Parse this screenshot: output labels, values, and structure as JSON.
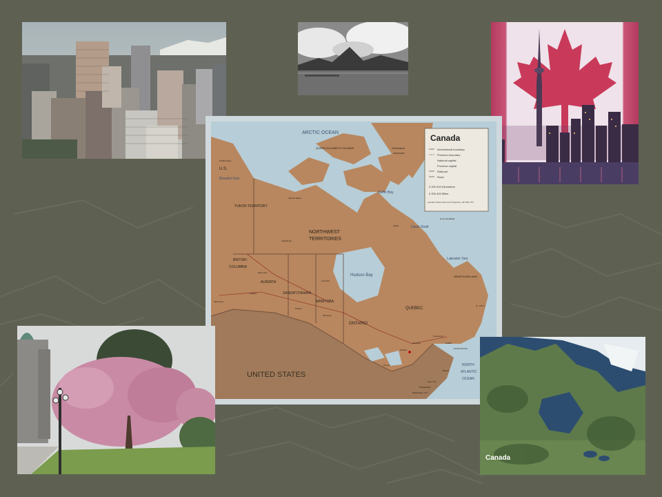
{
  "slide": {
    "background": "#5e6152",
    "map": {
      "legend": {
        "title": "Canada",
        "items": [
          "International boundary",
          "Province boundary",
          "National capital",
          "Province capital",
          "Railroad",
          "Road"
        ],
        "scale_km": "0    200    400 Kilometers",
        "scale_mi": "0    200    400 Miles",
        "projection": "Lambert Conformal Conic Projection, SP 49N 77N"
      },
      "labels": {
        "arctic_ocean": "ARCTIC OCEAN",
        "greenland": "Greenland",
        "greenland_denmark": "(DENMARK)",
        "beaufort_sea": "Beaufort Sea",
        "us": "U.S.",
        "prudhoe_bay": "Prudhoe Bay",
        "queen_elizabeth_islands": "QUEEN ELIZABETH ISLANDS",
        "baffin_bay": "Baffin Bay",
        "davis_strait": "Davis Strait",
        "nuuk": "Nuuk (Godthab)",
        "yukon": "YUKON TERRITORY",
        "nwt_1": "NORTHWEST",
        "nwt_2": "TERRITORIES",
        "bc_1": "BRITISH",
        "bc_2": "COLUMBIA",
        "alberta": "ALBERTA",
        "saskatchewan": "SASKATCHEWAN",
        "manitoba": "MANITOBA",
        "ontario": "ONTARIO",
        "quebec": "QUEBEC",
        "hudson_bay": "Hudson Bay",
        "labrador_sea": "Labrador Sea",
        "newfoundland": "NEWFOUNDLAND",
        "nova_scotia": "NOVA SCOTIA",
        "united_states": "UNITED STATES",
        "north_atlantic_1": "NORTH",
        "north_atlantic_2": "ATLANTIC",
        "north_atlantic_3": "OCEAN",
        "victoria_island": "Victoria Island",
        "yellowknife": "Yellowknife",
        "churchill": "Churchill",
        "iqaluit": "Iqaluit",
        "regina": "Regina",
        "winnipeg": "Winnipeg",
        "ottawa": "Ottawa",
        "toronto": "Toronto",
        "montreal": "Montreal",
        "halifax": "Halifax",
        "new_york": "New York",
        "washington": "Washington, D.C.",
        "vancouver": "Vancouver",
        "edmonton": "Edmonton",
        "calgary": "Calgary",
        "fredericton": "Fredericton",
        "st_johns": "St. John's",
        "philadelphia": "Philadelphia",
        "boston": "Boston"
      }
    },
    "satellite": {
      "caption": "Canada"
    }
  }
}
